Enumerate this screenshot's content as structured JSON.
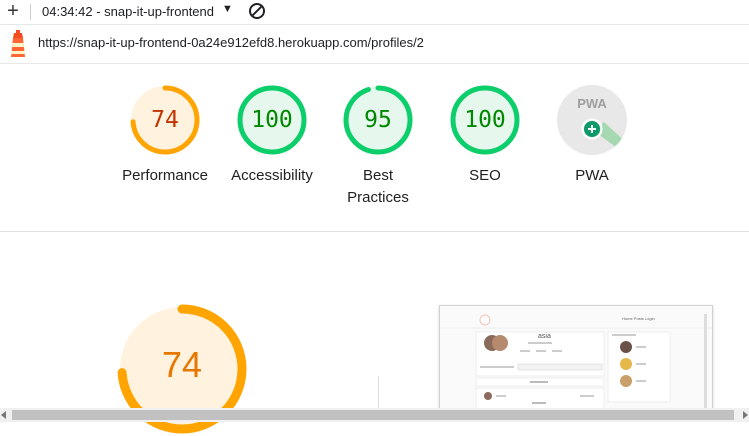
{
  "toolbar": {
    "add_icon": "plus-icon",
    "run_label": "04:34:42 - snap-it-up-frontend",
    "dropdown_icon": "caret-down-icon",
    "clear_icon": "block-icon"
  },
  "url": "https://snap-it-up-frontend-0a24e912efd8.herokuapp.com/profiles/2",
  "scores": [
    {
      "label": "Performance",
      "value": 74,
      "color": "#ffa400"
    },
    {
      "label": "Accessibility",
      "value": 100,
      "color": "#0cce6b"
    },
    {
      "label": "Best\nPractices",
      "value": 95,
      "color": "#0cce6b"
    },
    {
      "label": "SEO",
      "value": 100,
      "color": "#0cce6b"
    },
    {
      "label": "PWA",
      "value": null,
      "color": "#9e9e9e"
    }
  ],
  "pwa": {
    "badge": "PWA"
  },
  "main_gauge": {
    "value": 74,
    "color": "#ffa400"
  },
  "thumbnail": {
    "nav": "Home  Posts  Login",
    "username": "asia"
  },
  "colors": {
    "average": "#ffa400",
    "pass": "#0cce6b",
    "average_text": "#c33300",
    "pass_text": "#008800"
  }
}
